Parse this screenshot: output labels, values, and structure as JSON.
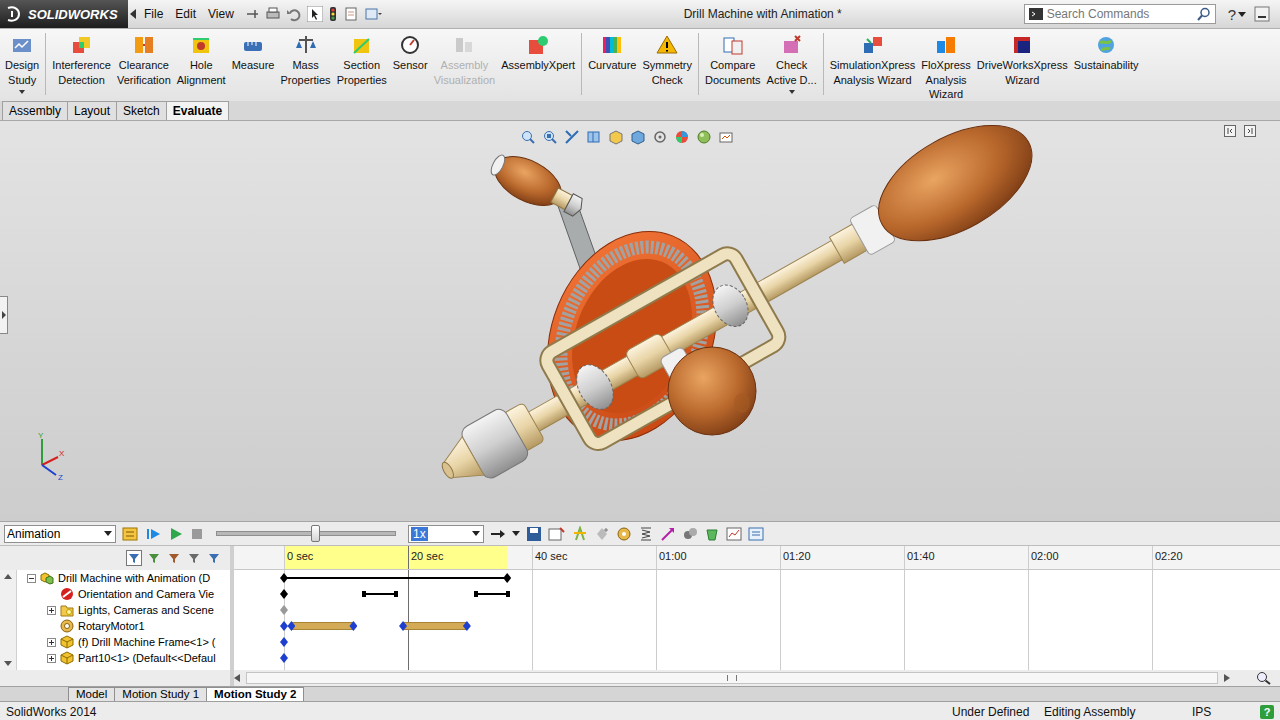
{
  "window": {
    "title": "Drill Machine with Animation *",
    "logo": "SOLIDWORKS"
  },
  "menu": [
    {
      "label": "File"
    },
    {
      "label": "Edit"
    },
    {
      "label": "View"
    }
  ],
  "search": {
    "placeholder": "Search Commands"
  },
  "help": "?",
  "ribbon": {
    "groups": [
      [
        {
          "lines": [
            "Design",
            "Study"
          ],
          "disabled": false,
          "dropdown": true
        }
      ],
      [
        {
          "lines": [
            "Interference",
            "Detection"
          ],
          "disabled": false,
          "dropdown": false
        },
        {
          "lines": [
            "Clearance",
            "Verification"
          ],
          "disabled": false,
          "dropdown": false
        },
        {
          "lines": [
            "Hole",
            "Alignment"
          ],
          "disabled": false,
          "dropdown": false
        },
        {
          "lines": [
            "Measure"
          ],
          "disabled": false,
          "dropdown": false
        },
        {
          "lines": [
            "Mass",
            "Properties"
          ],
          "disabled": false,
          "dropdown": false
        },
        {
          "lines": [
            "Section",
            "Properties"
          ],
          "disabled": false,
          "dropdown": false
        },
        {
          "lines": [
            "Sensor"
          ],
          "disabled": false,
          "dropdown": false
        },
        {
          "lines": [
            "Assembly",
            "Visualization"
          ],
          "disabled": true,
          "dropdown": false
        },
        {
          "lines": [
            "AssemblyXpert"
          ],
          "disabled": false,
          "dropdown": false
        }
      ],
      [
        {
          "lines": [
            "Curvature"
          ],
          "disabled": false,
          "dropdown": false
        },
        {
          "lines": [
            "Symmetry",
            "Check"
          ],
          "disabled": false,
          "dropdown": false
        }
      ],
      [
        {
          "lines": [
            "Compare",
            "Documents"
          ],
          "disabled": false,
          "dropdown": false
        },
        {
          "lines": [
            "Check",
            "Active D..."
          ],
          "disabled": false,
          "dropdown": true
        }
      ],
      [
        {
          "lines": [
            "SimulationXpress",
            "Analysis Wizard"
          ],
          "disabled": false,
          "dropdown": false
        },
        {
          "lines": [
            "FloXpress",
            "Analysis",
            "Wizard"
          ],
          "disabled": false,
          "dropdown": false
        },
        {
          "lines": [
            "DriveWorksXpress",
            "Wizard"
          ],
          "disabled": false,
          "dropdown": false
        },
        {
          "lines": [
            "Sustainability"
          ],
          "disabled": false,
          "dropdown": false
        }
      ]
    ]
  },
  "tabs": [
    {
      "label": "Assembly",
      "selected": false
    },
    {
      "label": "Layout",
      "selected": false
    },
    {
      "label": "Sketch",
      "selected": false
    },
    {
      "label": "Evaluate",
      "selected": true
    }
  ],
  "triad": [
    "Y",
    "X",
    "Z"
  ],
  "motion_toolbar": {
    "study_type": "Animation",
    "speed": "1x",
    "slider": {
      "level": 0.55
    }
  },
  "timeline": {
    "ticks": [
      "0 sec",
      "20 sec",
      "40 sec",
      "01:00",
      "01:20",
      "01:40",
      "02:00",
      "02:20"
    ],
    "tick_seconds": 20,
    "duration": 36,
    "cursor": 20,
    "rows": [
      {
        "label": "Drill Machine with Animation (D",
        "kind": "assembly",
        "level": 0,
        "expandable": true,
        "expanded": true,
        "key_color": "#000000",
        "keys": [
          0,
          36
        ],
        "bars": [
          {
            "from": 0,
            "to": 36,
            "kind": "line"
          }
        ]
      },
      {
        "label": "Orientation and Camera Vie",
        "kind": "camera",
        "level": 1,
        "expandable": false,
        "expanded": false,
        "key_color": "#000000",
        "keys": [
          0
        ],
        "bars": [
          {
            "from": 12.6,
            "to": 18.4,
            "kind": "span"
          },
          {
            "from": 30.6,
            "to": 36.5,
            "kind": "span"
          }
        ]
      },
      {
        "label": "Lights, Cameras and Scene",
        "kind": "lights",
        "level": 1,
        "expandable": true,
        "expanded": false,
        "key_color": "#9a9a9a",
        "keys": [
          0
        ],
        "bars": []
      },
      {
        "label": "RotaryMotor1",
        "kind": "motor",
        "level": 1,
        "expandable": false,
        "expanded": false,
        "key_color": "#1f3fcf",
        "keys": [
          0,
          1.2,
          11.2,
          19.2,
          29.5
        ],
        "bars": [
          {
            "from": 1.2,
            "to": 11.2,
            "kind": "fill"
          },
          {
            "from": 19.2,
            "to": 29.5,
            "kind": "fill"
          }
        ]
      },
      {
        "label": "(f) Drill Machine Frame<1> (",
        "kind": "part",
        "level": 1,
        "expandable": true,
        "expanded": false,
        "key_color": "#1f3fcf",
        "keys": [
          0
        ],
        "bars": []
      },
      {
        "label": "Part10<1> (Default<<Defaul",
        "kind": "part",
        "level": 1,
        "expandable": true,
        "expanded": false,
        "key_color": "#1f3fcf",
        "keys": [
          0
        ],
        "bars": []
      }
    ]
  },
  "study_tabs": [
    {
      "label": "Model",
      "selected": false
    },
    {
      "label": "Motion Study 1",
      "selected": false
    },
    {
      "label": "Motion Study 2",
      "selected": true
    }
  ],
  "status_bar": {
    "left": "SolidWorks 2014",
    "right": [
      "Under Defined",
      "Editing Assembly",
      "IPS"
    ],
    "help": "?"
  }
}
